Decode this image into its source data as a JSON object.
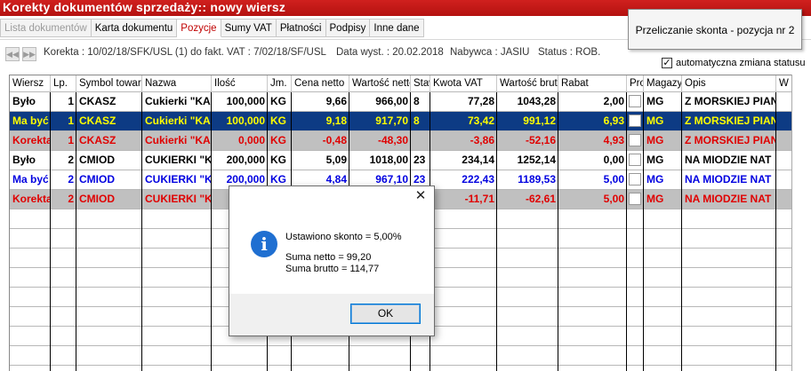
{
  "window": {
    "title": "Korekty dokumentów sprzedaży:: nowy wiersz"
  },
  "tabs": [
    {
      "label": "Lista dokumentów",
      "state": "disabled"
    },
    {
      "label": "Karta dokumentu",
      "state": "normal"
    },
    {
      "label": "Pozycje",
      "state": "active"
    },
    {
      "label": "Sumy VAT",
      "state": "normal"
    },
    {
      "label": "Płatności",
      "state": "normal"
    },
    {
      "label": "Podpisy",
      "state": "normal"
    },
    {
      "label": "Inne dane",
      "state": "normal"
    }
  ],
  "tooltip": {
    "text": "Przeliczanie skonta - pozycja nr 2"
  },
  "info": {
    "korekta": "Korekta : 10/02/18/SFK/USL (1) do fakt. VAT : 7/02/18/SF/USL",
    "data_wyst": "Data wyst. : 20.02.2018",
    "nabywca": "Nabywca : JASIU",
    "status": "Status : ROB."
  },
  "nav": {
    "first_icon": "rewind-icon",
    "next_icon": "forward-icon"
  },
  "auto_status": {
    "label": "automatyczna zmiana statusu",
    "checked": true
  },
  "grid": {
    "columns": [
      "Wiersz",
      "Lp.",
      "Symbol towaru",
      "Nazwa",
      "Ilość",
      "Jm.",
      "Cena netto",
      "Wartość netto",
      "Staw",
      "Kwota VAT",
      "Wartość brutto",
      "Rabat",
      "Proi",
      "Magazyn",
      "Opis",
      "W"
    ],
    "rows": [
      {
        "style": "normal",
        "cells": [
          "Było",
          "1",
          "CKASZ",
          "Cukierki \"KA",
          "100,000",
          "KG",
          "9,66",
          "966,00",
          "8",
          "77,28",
          "1043,28",
          "2,00",
          "",
          "MG",
          "Z MORSKIEJ PIAN"
        ]
      },
      {
        "style": "selected",
        "cells": [
          "Ma być",
          "1",
          "CKASZ",
          "Cukierki \"KA",
          "100,000",
          "KG",
          "9,18",
          "917,70",
          "8",
          "73,42",
          "991,12",
          "6,93",
          "",
          "MG",
          "Z MORSKIEJ PIAN"
        ]
      },
      {
        "style": "korekta",
        "cells": [
          "Korekta",
          "1",
          "CKASZ",
          "Cukierki \"KA",
          "0,000",
          "KG",
          "-0,48",
          "-48,30",
          "",
          "-3,86",
          "-52,16",
          "4,93",
          "",
          "MG",
          "Z MORSKIEJ PIAN"
        ]
      },
      {
        "style": "normal",
        "cells": [
          "Było",
          "2",
          "CMIOD",
          "CUKIERKI \"K",
          "200,000",
          "KG",
          "5,09",
          "1018,00",
          "23",
          "234,14",
          "1252,14",
          "0,00",
          "",
          "MG",
          "NA MIODZIE NAT"
        ]
      },
      {
        "style": "mabyc",
        "cells": [
          "Ma być",
          "2",
          "CMIOD",
          "CUKIERKI \"K",
          "200,000",
          "KG",
          "4,84",
          "967,10",
          "23",
          "222,43",
          "1189,53",
          "5,00",
          "",
          "MG",
          "NA MIODZIE NAT"
        ]
      },
      {
        "style": "korekta",
        "cells": [
          "Korekta",
          "2",
          "CMIOD",
          "CUKIERKI \"K",
          "",
          "",
          "",
          "",
          "",
          "-11,71",
          "-62,61",
          "5,00",
          "",
          "MG",
          "NA MIODZIE NAT"
        ]
      }
    ]
  },
  "dialog": {
    "icon": "info-icon",
    "close_icon": "close-icon",
    "line1": "Ustawiono skonto = 5,00%",
    "line2": "Suma netto = 99,20",
    "line3": "Suma brutto = 114,77",
    "ok_label": "OK"
  },
  "colors": {
    "title_bg": "#c0181a",
    "selected_bg": "#0d3b84",
    "selected_fg": "#ffff00",
    "korekta_bg": "#c0c0c0",
    "korekta_fg": "#e00000",
    "mabyc_fg": "#0000e0",
    "normal_fg": "#000000"
  }
}
